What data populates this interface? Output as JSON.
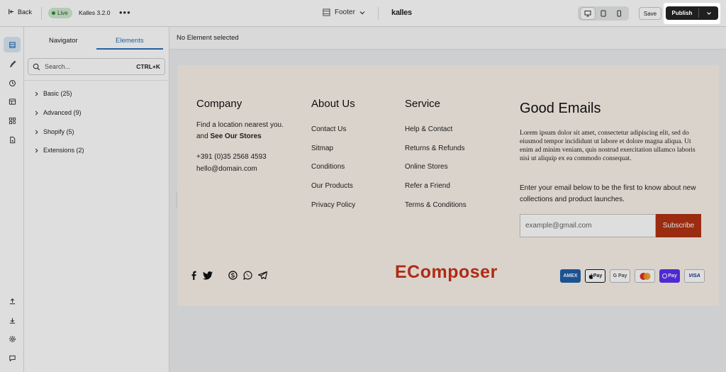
{
  "topbar": {
    "back_label": "Back",
    "live_label": "Live",
    "theme_name": "Kalles 3.2.0",
    "page_name": "Footer",
    "brand": "kalles",
    "save_label": "Save",
    "publish_label": "Publish"
  },
  "panel": {
    "tabs": [
      {
        "label": "Navigator"
      },
      {
        "label": "Elements"
      }
    ],
    "active_tab": "Elements",
    "search_placeholder": "Search...",
    "search_shortcut": "CTRL+K",
    "categories": [
      {
        "label": "Basic (25)"
      },
      {
        "label": "Advanced (9)"
      },
      {
        "label": "Shopify (5)"
      },
      {
        "label": "Extensions (2)"
      }
    ]
  },
  "canvas": {
    "status": "No Element selected"
  },
  "footer": {
    "company": {
      "title": "Company",
      "line1": "Find a location nearest you.",
      "line2_prefix": "and ",
      "line2_link": "See Our Stores",
      "phone": "+391 (0)35 2568 4593",
      "email": "hello@domain.com"
    },
    "about": {
      "title": "About Us",
      "links": [
        "Contact Us",
        "Sitmap",
        "Conditions",
        "Our Products",
        "Privacy Policy"
      ]
    },
    "service": {
      "title": "Service",
      "links": [
        "Help & Contact",
        "Returns & Refunds",
        "Online Stores",
        "Refer a Friend",
        "Terms & Conditions"
      ]
    },
    "emails": {
      "title": "Good Emails",
      "lorem": "Lorem ipsum dolor sit amet, consectetur adipiscing elit, sed do eiusmod tempor incididunt ut labore et dolore magna aliqua. Ut enim ad minim veniam, quis nostrud exercitation ullamco laboris nisi ut aliquip ex ea commodo consequat.",
      "desc": "Enter your email below to be the first to know about new collections and product launches.",
      "email_placeholder": "example@gmail.com",
      "subscribe_label": "Subscribe"
    },
    "logo": "EComposer",
    "payments": [
      "AMEX",
      "Pay",
      "G Pay",
      "",
      "Pay",
      "VISA"
    ]
  },
  "colors": {
    "accent": "#2b6fb7",
    "live": "#2e8b3e",
    "subscribe": "#b13314",
    "logo": "#c8321a",
    "footer_bg": "#fbf3ea"
  }
}
